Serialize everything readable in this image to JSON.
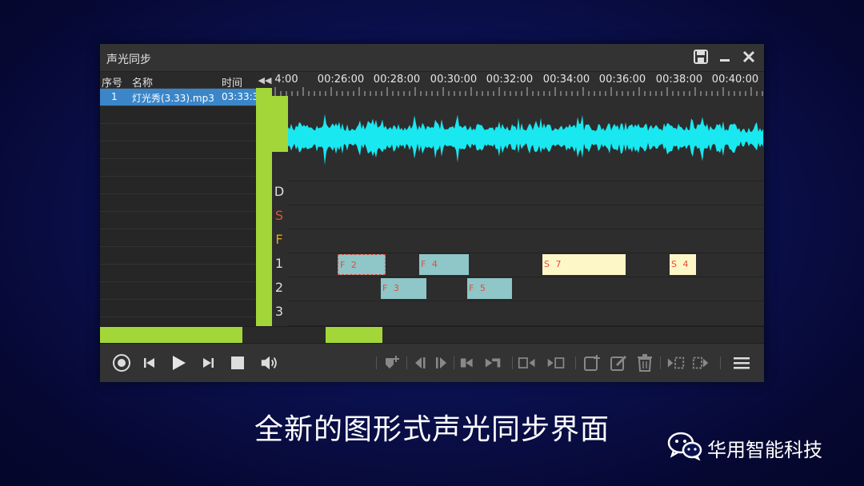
{
  "window": {
    "title": "声光同步"
  },
  "list": {
    "headers": {
      "index": "序号",
      "name": "名称",
      "time": "时间"
    },
    "rows": [
      {
        "index": "1",
        "name": "灯光秀(3.33).mp3",
        "time": "03:33:3"
      }
    ]
  },
  "ruler": {
    "labels": [
      "4:00",
      "00:26:00",
      "00:28:00",
      "00:30:00",
      "00:32:00",
      "00:34:00",
      "00:36:00",
      "00:38:00",
      "00:40:00"
    ]
  },
  "tracks": {
    "labels": [
      {
        "text": "D",
        "color": "#dcdcdc"
      },
      {
        "text": "S",
        "color": "#e0562e"
      },
      {
        "text": "F",
        "color": "#e0a81c"
      },
      {
        "text": "1",
        "color": "#dcdcdc"
      },
      {
        "text": "2",
        "color": "#dcdcdc"
      },
      {
        "text": "3",
        "color": "#dcdcdc"
      }
    ]
  },
  "clips": [
    {
      "label": "F 2",
      "lane": 1,
      "type": "F"
    },
    {
      "label": "F 4",
      "lane": 1,
      "type": "F"
    },
    {
      "label": "S 7",
      "lane": 1,
      "type": "S"
    },
    {
      "label": "S 4",
      "lane": 1,
      "type": "S"
    },
    {
      "label": "F 3",
      "lane": 2,
      "type": "F"
    },
    {
      "label": "F 5",
      "lane": 2,
      "type": "F"
    }
  ],
  "colors": {
    "accent": "#a3d639",
    "waveform": "#19e8f0",
    "f_clip": "#8fc6c8",
    "s_clip": "#fdf7c8",
    "selection": "#3a86c8"
  },
  "toolbar": {
    "buttons": [
      "record-icon",
      "prev-icon",
      "play-icon",
      "next-icon",
      "stop-icon",
      "volume-icon",
      "add-marker-icon",
      "step-back-icon",
      "step-forward-icon",
      "align-left-icon",
      "align-right-icon",
      "frame-left-icon",
      "frame-right-icon",
      "new-clip-icon",
      "edit-icon",
      "delete-icon",
      "import-icon",
      "export-icon",
      "menu-icon"
    ]
  },
  "caption": "全新的图形式声光同步界面",
  "brand": {
    "name": "华用智能科技",
    "icon": "wechat-icon"
  }
}
